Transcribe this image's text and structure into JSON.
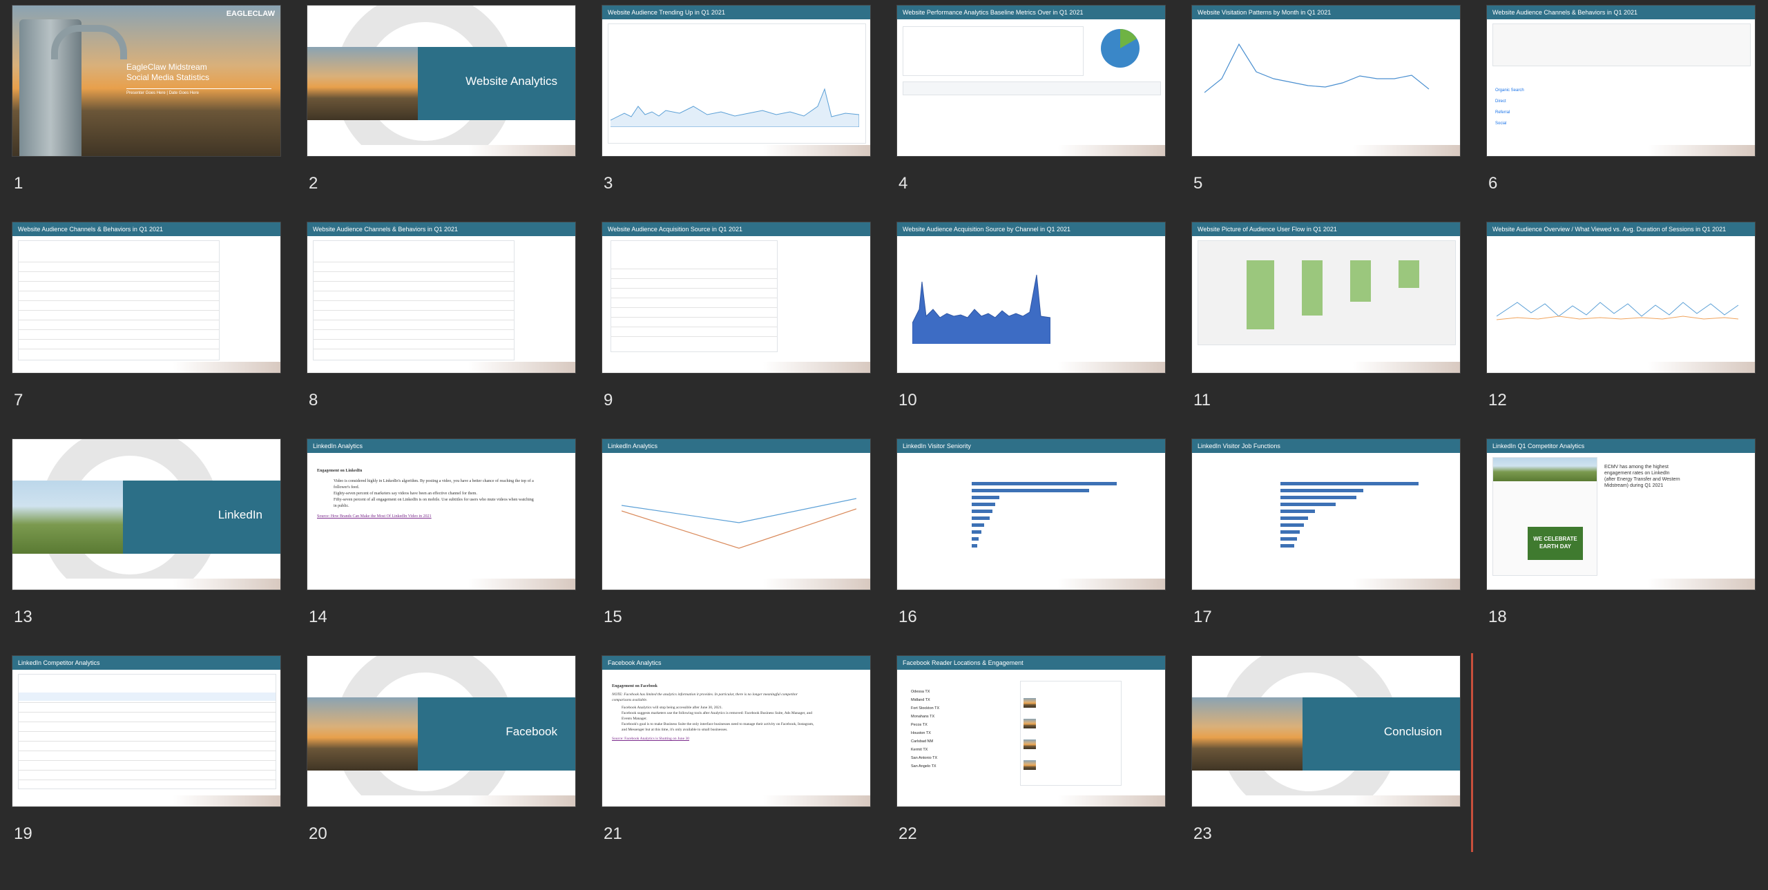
{
  "slides": [
    {
      "num": "1",
      "type": "title",
      "title": "EagleClaw Midstream\nSocial Media Statistics",
      "subtitle": "Presenter Goes Here | Date Goes Here",
      "brand": "EAGLECLAW"
    },
    {
      "num": "2",
      "type": "section",
      "title": "Website Analytics"
    },
    {
      "num": "3",
      "type": "content",
      "title": "Website Audience Trending Up in Q1 2021"
    },
    {
      "num": "4",
      "type": "content",
      "title": "Website Performance Analytics Baseline Metrics Over in Q1 2021"
    },
    {
      "num": "5",
      "type": "content",
      "title": "Website Visitation Patterns by Month in Q1 2021"
    },
    {
      "num": "6",
      "type": "content",
      "title": "Website Audience Channels & Behaviors in Q1 2021",
      "rows": [
        "Organic Search",
        "Direct",
        "Referral",
        "Social"
      ]
    },
    {
      "num": "7",
      "type": "content",
      "title": "Website Audience Channels & Behaviors in Q1 2021"
    },
    {
      "num": "8",
      "type": "content",
      "title": "Website Audience Channels & Behaviors in Q1 2021"
    },
    {
      "num": "9",
      "type": "content",
      "title": "Website Audience Acquisition Source in Q1 2021"
    },
    {
      "num": "10",
      "type": "content",
      "title": "Website Audience Acquisition Source by Channel in Q1 2021"
    },
    {
      "num": "11",
      "type": "content",
      "title": "Website Picture of Audience User Flow in Q1 2021"
    },
    {
      "num": "12",
      "type": "content",
      "title": "Website Audience Overview / What Viewed vs. Avg. Duration of Sessions in Q1 2021"
    },
    {
      "num": "13",
      "type": "section",
      "title": "LinkedIn"
    },
    {
      "num": "14",
      "type": "text",
      "title": "LinkedIn Analytics",
      "heading": "Engagement on LinkedIn",
      "bullets": [
        "Video is considered highly in LinkedIn's algorithm. By posting a video, you have a better chance of reaching the top of a follower's feed.",
        "Eighty-seven percent of marketers say videos have been an effective channel for them.",
        "Fifty-seven percent of all engagement on LinkedIn is on mobile. Use subtitles for users who mute videos when watching in public."
      ],
      "source": "Source: How Brands Can Make the Most Of LinkedIn Video in 2021"
    },
    {
      "num": "15",
      "type": "content",
      "title": "LinkedIn Analytics"
    },
    {
      "num": "16",
      "type": "content",
      "title": "LinkedIn Visitor Seniority"
    },
    {
      "num": "17",
      "type": "content",
      "title": "LinkedIn Visitor Job Functions"
    },
    {
      "num": "18",
      "type": "content",
      "title": "LinkedIn Q1 Competitor Analytics",
      "note": "ECMV has among the highest engagement rates on LinkedIn (after Energy Transfer and Western Midstream) during Q1 2021",
      "banner": "WE CELEBRATE EARTH DAY"
    },
    {
      "num": "19",
      "type": "content",
      "title": "LinkedIn Competitor Analytics"
    },
    {
      "num": "20",
      "type": "section",
      "title": "Facebook"
    },
    {
      "num": "21",
      "type": "text",
      "title": "Facebook Analytics",
      "heading": "Engagement on Facebook",
      "bullets": [
        "NOTE: Facebook has limited the analytics information it provides. In particular, there is no longer meaningful competitor comparisons available.",
        "Facebook Analytics will stop being accessible after June 30, 2021.",
        "Facebook suggests marketers use the following tools after Analytics is removed: Facebook Business Suite, Ads Manager, and Events Manager.",
        "Facebook's goal is to make Business Suite the only interface businesses need to manage their activity on Facebook, Instagram, and Messenger but at this time, it's only available to small businesses."
      ],
      "source": "Source: Facebook Analytics is Shutting on June 30"
    },
    {
      "num": "22",
      "type": "content",
      "title": "Facebook Reader Locations & Engagement",
      "locations": [
        "Odessa TX",
        "Midland TX",
        "Fort Stockton TX",
        "Monahans TX",
        "Pecos TX",
        "Houston TX",
        "Carlsbad NM",
        "Kermit TX",
        "San Antonio TX",
        "San Angelo TX"
      ]
    },
    {
      "num": "23",
      "type": "section",
      "title": "Conclusion"
    }
  ]
}
